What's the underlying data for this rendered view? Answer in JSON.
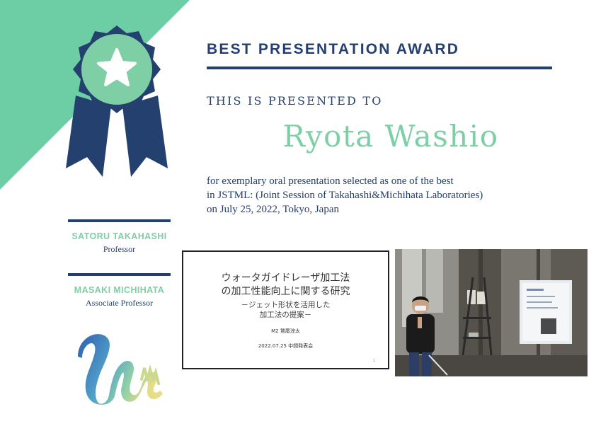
{
  "award": {
    "title": "BEST PRESENTATION AWARD",
    "presented_to": "THIS IS PRESENTED TO",
    "recipient": "Ryota Washio",
    "description_lines": [
      "for exemplary oral presentation selected as one of the best",
      "in JSTML: (Joint Session of Takahashi&Michihata Laboratories)",
      "on July 25, 2022, Tokyo, Japan"
    ]
  },
  "signatories": [
    {
      "name": "SATORU TAKAHASHI",
      "title": "Professor"
    },
    {
      "name": "MASAKI MICHIHATA",
      "title": "Associate Professor"
    }
  ],
  "slide": {
    "title_lines": [
      "ウォータガイドレーザ加工法",
      "の加工性能向上に関する研究"
    ],
    "subtitle_lines": [
      "－ジェット形状を活用した",
      "加工法の提案－"
    ],
    "author": "M2 鷲尾涼太",
    "date": "2022.07.25 中間発表会",
    "page": "1"
  },
  "colors": {
    "navy": "#24406f",
    "mint": "#7fcfa6",
    "corner_mint": "#6dcda4"
  },
  "icons": {
    "award_ribbon": "ribbon-medal-star-icon",
    "logo": "lab-logo-stylized-h-icon"
  }
}
